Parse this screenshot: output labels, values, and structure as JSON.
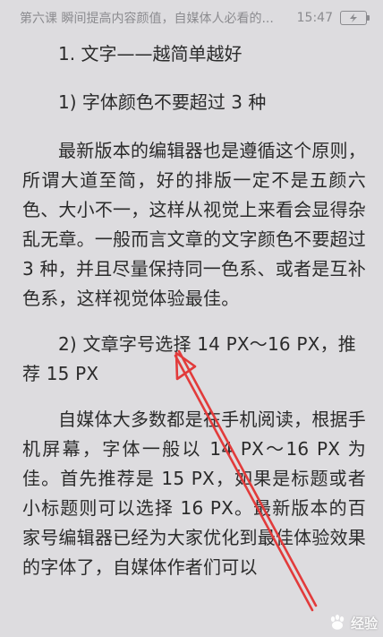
{
  "status_bar": {
    "title": "第六课 瞬间提高内容颜值，自媒体人必看的...",
    "time": "15:47",
    "battery_icon": "battery-charging-icon"
  },
  "article": {
    "heading_1": "1. 文字——越简单越好",
    "heading_2": "1) 字体颜色不要超过 3 种",
    "paragraph_1": "最新版本的编辑器也是遵循这个原则，所谓大道至简，好的排版一定不是五颜六色、大小不一，这样从视觉上来看会显得杂乱无章。一般而言文章的文字颜色不要超过 3 种，并且尽量保持同一色系、或者是互补色系，这样视觉体验最佳。",
    "subheading_2": "2) 文章字号选择 14 PX～16 PX，推荐 15 PX",
    "paragraph_2": "自媒体大多数都是在手机阅读，根据手机屏幕，字体一般以 14 PX～16 PX 为佳。首先推荐是 15 PX，如果是标题或者小标题则可以选择 16 PX。最新版本的百家号编辑器已经为大家优化到最佳体验效果的字体了，自媒体作者们可以"
  },
  "annotation": {
    "arrow_color": "#e23b3b",
    "arrow_icon": "red-arrow-annotation"
  },
  "watermark": {
    "text": "经验",
    "icon": "baidu-paw-icon"
  }
}
